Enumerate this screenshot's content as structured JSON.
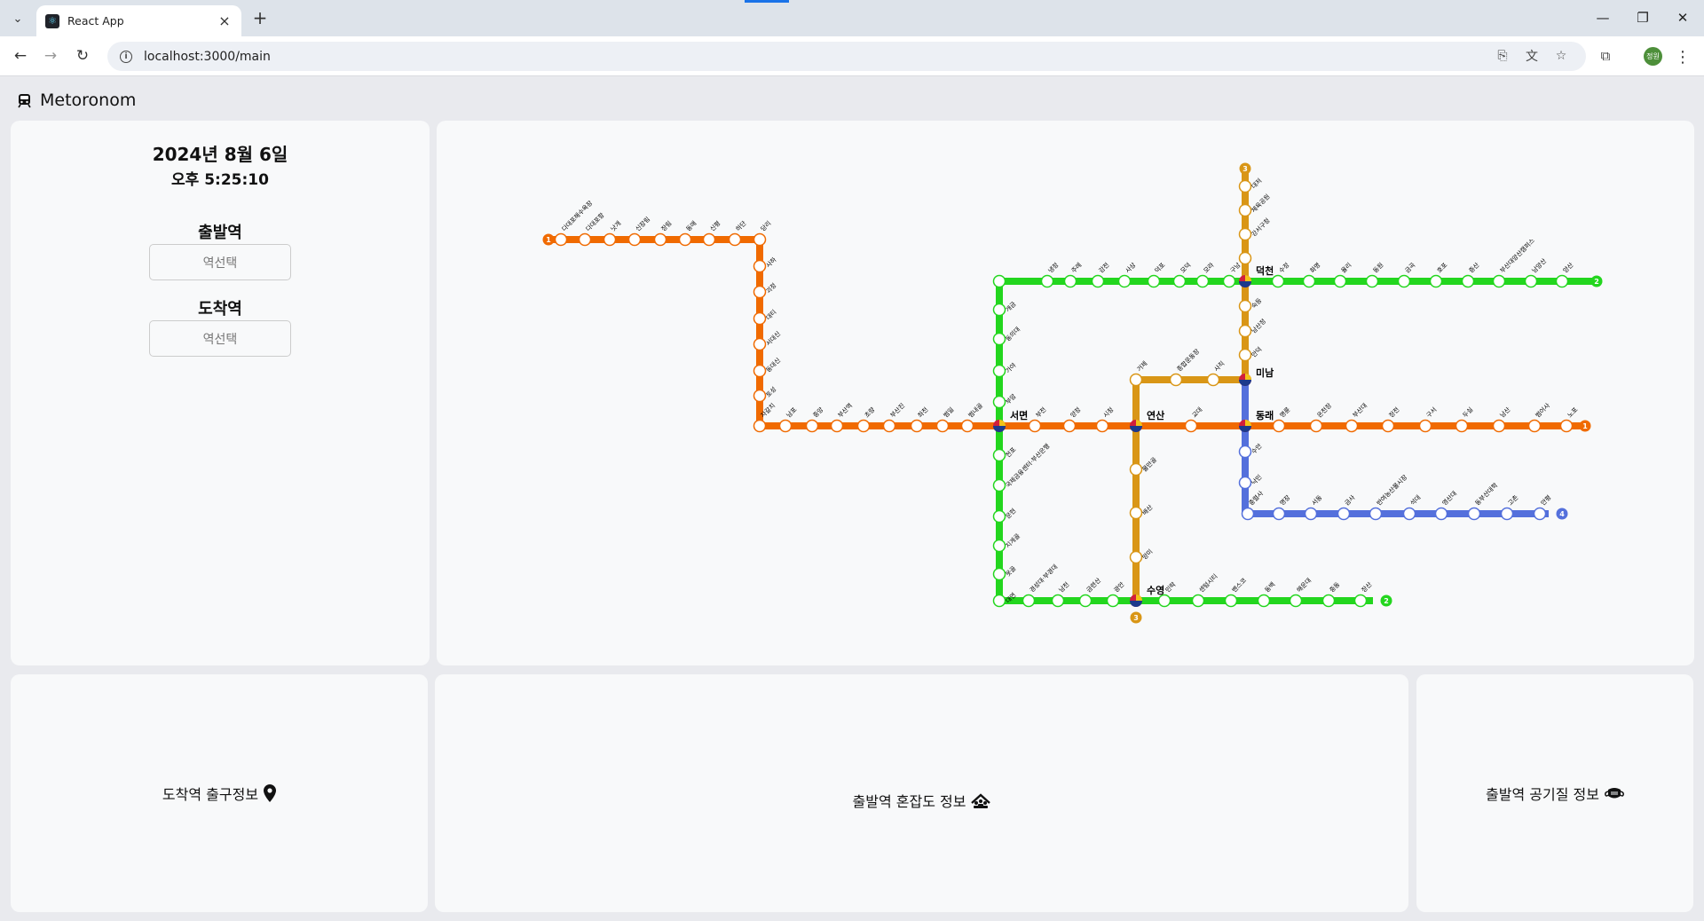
{
  "browser": {
    "tab_title": "React App",
    "url": "localhost:3000/main",
    "profile_initials": "정원"
  },
  "app": {
    "title": "Metoronom",
    "date": "2024년 8월 6일",
    "time": "오후 5:25:10",
    "departure_label": "출발역",
    "departure_placeholder": "역선택",
    "arrival_label": "도착역",
    "arrival_placeholder": "역선택",
    "exit_info_label": "도착역 출구정보",
    "congestion_label": "출발역 혼잡도 정보",
    "air_quality_label": "출발역 공기질 정보"
  },
  "metro_map": {
    "line_colors": {
      "1": "#f06a00",
      "2": "#23d61e",
      "3": "#d99616",
      "4": "#5470dc"
    },
    "line_badges": [
      "1",
      "2",
      "3",
      "4"
    ],
    "stations": {
      "line1_top": [
        "다대포해수욕장",
        "다대포항",
        "낫개",
        "신장림",
        "장림",
        "동매",
        "신평",
        "하단"
      ],
      "line1_left": [
        "당리",
        "사하",
        "괴정",
        "대티",
        "서대신",
        "동대신",
        "토성"
      ],
      "line1_bottom": [
        "자갈치",
        "남포",
        "중앙",
        "부산역",
        "초량",
        "부산진",
        "좌천",
        "범일",
        "범내골"
      ],
      "line1_right": [
        "부전",
        "양정",
        "시청",
        "교대",
        "명륜",
        "온천장",
        "부산대",
        "장전",
        "구서",
        "두실",
        "남산",
        "범어사",
        "노포"
      ],
      "line2_top": [
        "양산",
        "남양산",
        "부산대양산캠퍼스",
        "증산",
        "호포",
        "금곡",
        "동원",
        "율리",
        "화명",
        "수정",
        "구포",
        "구남",
        "모라",
        "모덕",
        "덕포",
        "사상",
        "감전",
        "주례",
        "냉정"
      ],
      "line2_left": [
        "개금",
        "동의대",
        "가야",
        "부암",
        "전포",
        "국제금융센터·부산은행",
        "문현",
        "지게골",
        "못골",
        "대연"
      ],
      "line2_bottom": [
        "경성대·부경대",
        "남천",
        "금련산",
        "광안",
        "민락",
        "센텀시티",
        "벤스코",
        "동백",
        "해운대",
        "중동",
        "장산"
      ],
      "line3": [
        "대저",
        "체육공원",
        "강서구청",
        "숙등",
        "남산정",
        "만덕",
        "거제",
        "종합운동장",
        "사직",
        "물만골",
        "배산",
        "망미"
      ],
      "line4": [
        "수안",
        "낙민",
        "충렬사",
        "명장",
        "서동",
        "금사",
        "반여농산물시장",
        "석대",
        "영산대",
        "동부산대학",
        "고촌",
        "안평"
      ],
      "transfers": [
        "서면",
        "연산",
        "덕천",
        "미남",
        "동래",
        "수영"
      ]
    }
  }
}
